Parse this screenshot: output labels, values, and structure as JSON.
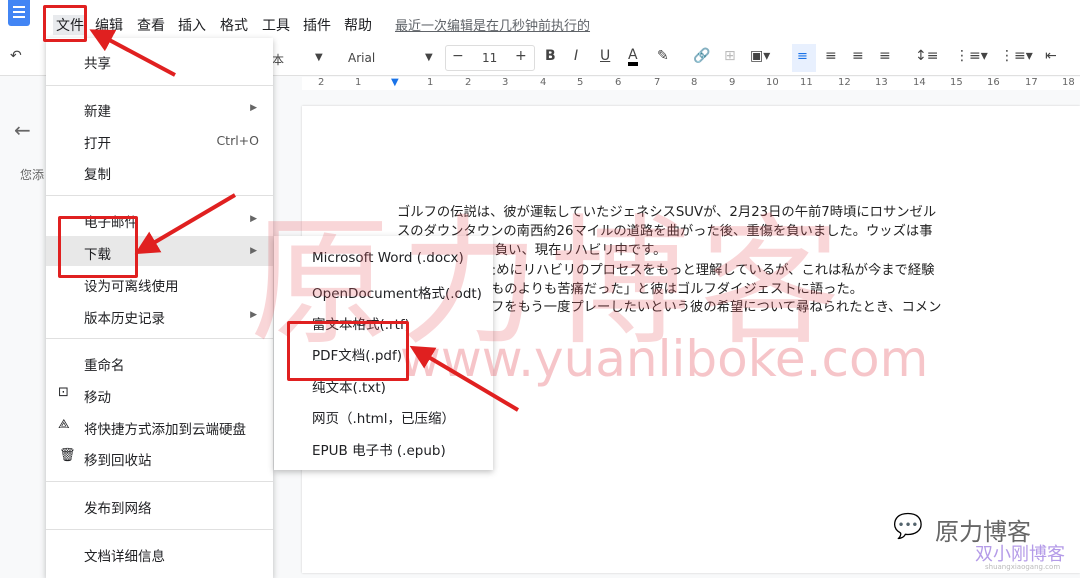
{
  "menubar": {
    "items": [
      "文件",
      "编辑",
      "查看",
      "插入",
      "格式",
      "工具",
      "插件",
      "帮助"
    ],
    "last_edit": "最近一次编辑是在几秒钟前执行的"
  },
  "toolbar": {
    "style_partial": "本",
    "font": "Arial",
    "font_size": "11",
    "minus": "−",
    "plus": "+",
    "bold": "B",
    "italic": "I",
    "underline": "U",
    "text_color": "A"
  },
  "ruler": [
    "2",
    "1",
    "1",
    "2",
    "3",
    "4",
    "5",
    "6",
    "7",
    "8",
    "9",
    "10",
    "11",
    "12",
    "13",
    "14",
    "15",
    "16",
    "17",
    "18"
  ],
  "side": {
    "back": "←",
    "hint": "您添"
  },
  "file_menu": {
    "items": [
      {
        "label": "共享"
      },
      {
        "label": "新建",
        "submenu": true
      },
      {
        "label": "打开",
        "shortcut": "Ctrl+O"
      },
      {
        "label": "复制"
      },
      {
        "label": "电子邮件",
        "submenu": true
      },
      {
        "label": "下载",
        "submenu": true,
        "highlighted": true
      },
      {
        "label": "设为可离线使用"
      },
      {
        "label": "版本历史记录",
        "submenu": true
      },
      {
        "label": "重命名"
      },
      {
        "label": "移动",
        "icon": "folder-move-icon"
      },
      {
        "label": "将快捷方式添加到云端硬盘",
        "icon": "drive-shortcut-icon"
      },
      {
        "label": "移到回收站",
        "icon": "trash-icon"
      },
      {
        "label": "发布到网络"
      },
      {
        "label": "文档详细信息"
      }
    ]
  },
  "download_menu": {
    "items": [
      "Microsoft Word (.docx)",
      "OpenDocument格式(.odt)",
      "富文本格式(.rtf)",
      "PDF文档(.pdf)",
      "纯文本(.txt)",
      "网页（.html，已压缩）",
      "EPUB 电子书 (.epub)"
    ]
  },
  "document": {
    "lines": [
      "ゴルフの伝説は、彼が運転していたジェネシスSUVが、2月23日の午前7時頃にロサンゼル",
      "スのダウンタウンの南西約26マイルの道路を曲がった後、重傷を負いました。ウッズは事",
      "重傷を負い、現在リハビリ中です。",
      "ためにリハビリのプロセスをもっと理解しているが、これは私が今まで経験",
      "ものよりも苦痛だった」と彼はゴルフダイジェストに語った。",
      "フをもう一度プレーしたいという彼の希望について尋ねられたとき、コメン"
    ]
  },
  "watermark": {
    "text": "原力博客",
    "url": "www.yuanliboke.com",
    "wechat": "原力博客",
    "site": "双小刚博客",
    "site_url": "shuangxiaogang.com"
  },
  "colors": {
    "accent": "#1a73e8",
    "annotation": "#e02020"
  }
}
